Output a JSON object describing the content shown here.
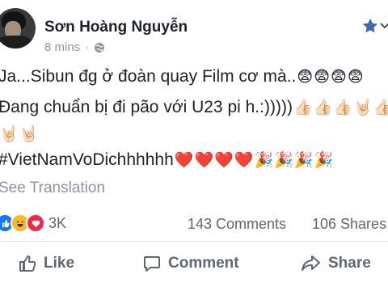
{
  "post": {
    "author": "Sơn Hoàng Nguyễn",
    "time": "8 mins",
    "separator": "·",
    "lines": {
      "l1_text": "Ja...Sibun đg ở đoàn quay Film cơ mà..",
      "l1_emoji": [
        "😨",
        "😨",
        "😨",
        "😨"
      ],
      "l2_text": "Đang chuẩn bị đi pão với U23 pi h.:)))))",
      "l2_emoji": [
        "👍🏻",
        "👍🏻",
        "👍🏻",
        "🤘🏻",
        "👍🏻"
      ],
      "l3_emoji": [
        "🤘🏻",
        "🤘🏻"
      ],
      "l4_text": "#VietNamVoDichhhhhh",
      "l4_emoji": [
        "❤️",
        "❤️",
        "❤️",
        "❤️",
        "🎉",
        "🎉",
        "🎉",
        "🎉"
      ]
    },
    "see_translation": "See Translation"
  },
  "stats": {
    "reaction_count": "3K",
    "comments": "143 Comments",
    "shares": "106 Shares"
  },
  "actions": {
    "like": "Like",
    "comment": "Comment",
    "share": "Share"
  },
  "colors": {
    "brand": "#1877f2",
    "love": "#f0284a",
    "haha": "#f7b928",
    "muted": "#90949c"
  },
  "icons": [
    "star-icon",
    "chevron-down-icon",
    "globe-icon",
    "like-reaction-icon",
    "haha-reaction-icon",
    "love-reaction-icon",
    "thumbs-up-icon",
    "comment-icon",
    "share-icon"
  ]
}
